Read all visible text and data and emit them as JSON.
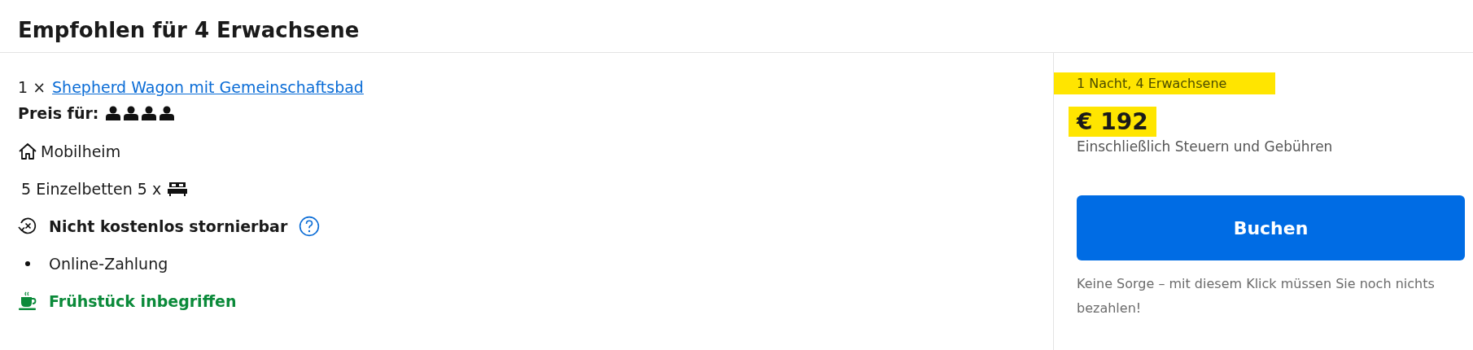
{
  "heading": "Empfohlen für 4 Erwachsene",
  "room": {
    "quantity": "1 ×",
    "name": "Shepherd Wagon mit Gemeinschaftsbad"
  },
  "price_for": {
    "label": "Preis für:",
    "guests": [
      {
        "kind": "adult"
      },
      {
        "kind": "adult"
      },
      {
        "kind": "adult"
      },
      {
        "kind": "adult"
      }
    ]
  },
  "features": [
    {
      "kind": "house",
      "text": "Mobilheim"
    },
    {
      "kind": "beds",
      "text": "5 Einzelbetten 5 x"
    },
    {
      "kind": "cancel",
      "text": "Nicht kostenlos stornierbar"
    },
    {
      "kind": "bullet",
      "text": "Online-Zahlung"
    },
    {
      "kind": "breakfast",
      "text": "Frühstück inbegriffen"
    }
  ],
  "summary": {
    "stay": {
      "text": "1 Nacht, 4 Erwachsene",
      "highlighted": true
    },
    "price": {
      "text": "€ 192",
      "highlighted": true
    },
    "note": "Einschließlich Steuern und Gebühren",
    "button": "Buchen",
    "reassurance": "Keine Sorge – mit diesem Klick müssen Sie noch nichts bezahlen!"
  }
}
